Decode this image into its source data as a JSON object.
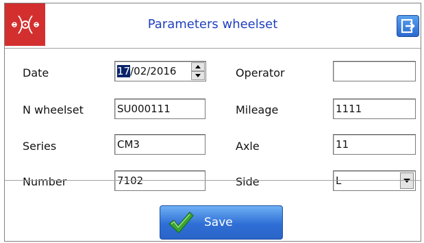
{
  "header": {
    "title": "Parameters wheelset",
    "logo_icon": "wheelset-logo-icon",
    "exit_icon": "exit-icon"
  },
  "form": {
    "date": {
      "label": "Date",
      "day": "17",
      "rest": "/02/2016"
    },
    "operator": {
      "label": "Operator",
      "value": ""
    },
    "wheelset": {
      "label": "N wheelset",
      "value": "SU000111"
    },
    "mileage": {
      "label": "Mileage",
      "value": "1111"
    },
    "series": {
      "label": "Series",
      "value": "CM3"
    },
    "axle": {
      "label": "Axle",
      "value": "11"
    },
    "number": {
      "label": "Number",
      "value": "7102"
    },
    "side": {
      "label": "Side",
      "value": "L"
    }
  },
  "footer": {
    "save_label": "Save",
    "save_icon": "checkmark-icon"
  },
  "colors": {
    "logo_bg": "#d32f2f",
    "title": "#1f3fbf",
    "button_blue": "#2f6fd6",
    "check_green": "#3aa632"
  }
}
